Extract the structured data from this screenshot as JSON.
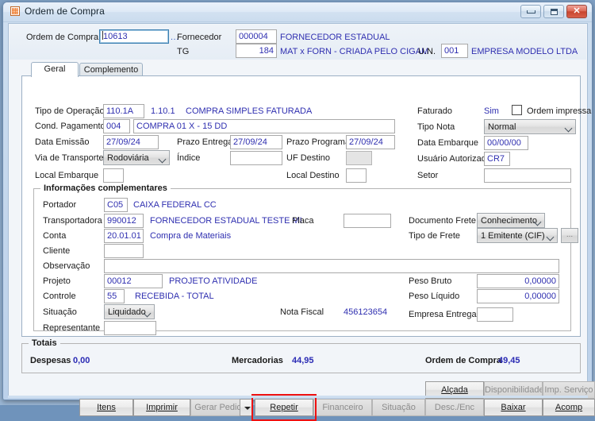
{
  "window": {
    "title": "Ordem de Compra",
    "icon": "app-grid-icon",
    "controls": {
      "minimize": "minimize-icon",
      "maximize": "maximize-icon",
      "close": "close-icon"
    }
  },
  "header": {
    "ordem_label": "Ordem de Compra",
    "ordem_value": "10613",
    "lookup": "...",
    "fornecedor_label": "Fornecedor",
    "fornecedor_code": "000004",
    "fornecedor_name": "FORNECEDOR ESTADUAL",
    "tg_label": "TG",
    "tg_value": "184",
    "tg_desc": "MAT x FORN - CRIADA PELO CIGAM",
    "un_label": "U.N.",
    "un_value": "001",
    "un_name": "EMPRESA MODELO LTDA"
  },
  "tabs": [
    {
      "label": "Geral",
      "active": true
    },
    {
      "label": "Complemento",
      "active": false
    }
  ],
  "geral": {
    "tipo_operacao_label": "Tipo de Operação",
    "tipo_operacao_value": "110.1A",
    "tipo_operacao_code": "1.10.1",
    "tipo_operacao_desc": "COMPRA SIMPLES FATURADA",
    "cond_pagamento_label": "Cond. Pagamento",
    "cond_pagamento_value": "004",
    "cond_pagamento_desc": "COMPRA 01 X - 15 DD",
    "data_emissao_label": "Data Emissão",
    "data_emissao_value": "27/09/24",
    "prazo_entrega_label": "Prazo Entrega",
    "prazo_entrega_value": "27/09/24",
    "prazo_programado_label": "Prazo Programado",
    "prazo_programado_value": "27/09/24",
    "via_transporte_label": "Via de Transporte",
    "via_transporte_value": "Rodoviária",
    "indice_label": "Índice",
    "indice_value": "",
    "uf_destino_label": "UF Destino",
    "uf_destino_value": "",
    "local_embarque_label": "Local Embarque",
    "local_embarque_value": "",
    "local_destino_label": "Local Destino",
    "local_destino_value": "",
    "faturado_label": "Faturado",
    "faturado_value": "Sim",
    "ordem_impressa_label": "Ordem impressa",
    "ordem_impressa_checked": false,
    "tipo_nota_label": "Tipo Nota",
    "tipo_nota_value": "Normal",
    "data_embarque_label": "Data Embarque",
    "data_embarque_value": "00/00/00",
    "usuario_autorizado_label": "Usuário Autorizado",
    "usuario_autorizado_value": "CR7",
    "setor_label": "Setor",
    "setor_value": ""
  },
  "complementares": {
    "title": "Informações complementares",
    "portador_label": "Portador",
    "portador_value": "C05",
    "portador_desc": "CAIXA FEDERAL CC",
    "transportadora_label": "Transportadora",
    "transportadora_value": "990012",
    "transportadora_desc": "FORNECEDOR ESTADUAL TESTE MI",
    "placa_label": "Placa",
    "placa_value": "",
    "documento_frete_label": "Documento Frete",
    "documento_frete_value": "Conhecimento",
    "conta_label": "Conta",
    "conta_value": "20.01.01",
    "conta_desc": "Compra de Materiais",
    "tipo_frete_label": "Tipo de Frete",
    "tipo_frete_value": "1 Emitente (CIF)",
    "tipo_frete_more": "...",
    "cliente_label": "Cliente",
    "cliente_value": "",
    "observacao_label": "Observação",
    "observacao_value": "",
    "projeto_label": "Projeto",
    "projeto_value": "00012",
    "projeto_desc": "PROJETO ATIVIDADE",
    "peso_bruto_label": "Peso Bruto",
    "peso_bruto_value": "0,00000",
    "controle_label": "Controle",
    "controle_value": "55",
    "controle_desc": "RECEBIDA - TOTAL",
    "peso_liquido_label": "Peso Líquido",
    "peso_liquido_value": "0,00000",
    "situacao_label": "Situação",
    "situacao_value": "Liquidado",
    "nota_fiscal_label": "Nota Fiscal",
    "nota_fiscal_value": "456123654",
    "representante_label": "Representante",
    "representante_value": "",
    "empresa_entrega_label": "Empresa Entrega",
    "empresa_entrega_value": ""
  },
  "totais": {
    "title": "Totais",
    "despesas_label": "Despesas",
    "despesas_value": "0,00",
    "mercadorias_label": "Mercadorias",
    "mercadorias_value": "44,95",
    "ordem_label": "Ordem de Compra",
    "ordem_value": "49,45"
  },
  "toolbar_top": [
    {
      "label": "Alçada",
      "disabled": false
    },
    {
      "label": "Disponibilidade",
      "disabled": true
    },
    {
      "label": "Imp. Serviço",
      "disabled": true
    }
  ],
  "toolbar_bottom": [
    {
      "label": "Itens",
      "disabled": false
    },
    {
      "label": "Imprimir",
      "disabled": false
    },
    {
      "label": "Gerar Pedido",
      "disabled": true
    },
    {
      "label": "Repetir",
      "disabled": false,
      "highlighted": true
    },
    {
      "label": "Financeiro",
      "disabled": true
    },
    {
      "label": "Situação",
      "disabled": true
    },
    {
      "label": "Desc./Enc",
      "disabled": true
    },
    {
      "label": "Baixar",
      "disabled": false
    },
    {
      "label": "Acomp",
      "disabled": false
    }
  ],
  "colors": {
    "field_text": "#2f2fb0",
    "highlight_box": "#ee1111",
    "window_bg": "#c3d6ec",
    "client_bg": "#f2f5f9"
  }
}
